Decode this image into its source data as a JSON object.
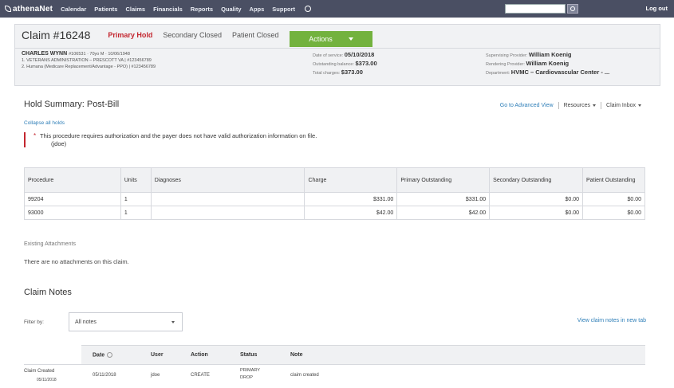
{
  "nav": {
    "logo": "athenaNet",
    "items": [
      "Calendar",
      "Patients",
      "Claims",
      "Financials",
      "Reports",
      "Quality",
      "Apps",
      "Support"
    ],
    "logout": "Log out"
  },
  "claim": {
    "title": "Claim #16248",
    "statuses": [
      "Primary Hold",
      "Secondary Closed",
      "Patient Closed"
    ],
    "actions_label": "Actions",
    "patient_name": "CHARLES WYNN",
    "patient_info": "#106531 · 70yo M · 10/06/1948",
    "insurance1": "1. VETERANS ADMINISTRATION – PRESCOTT VA | #123456789",
    "insurance2": "2. Humana (Medicare Replacement/Advantage - PPO) | #123456789",
    "date_of_service_label": "Date of service:",
    "date_of_service": "05/10/2018",
    "outstanding_label": "Outstanding balance:",
    "outstanding": "$373.00",
    "total_charges_label": "Total charges:",
    "total_charges": "$373.00",
    "supervising_label": "Supervising Provider:",
    "supervising": "William Koenig",
    "rendering_label": "Rendering Provider:",
    "rendering": "William Koenig",
    "department_label": "Department:",
    "department": "HVMC – Cardiovascular Center - ..."
  },
  "hold": {
    "title": "Hold Summary: Post-Bill",
    "advanced_view": "Go to Advanced View",
    "resources": "Resources",
    "claim_inbox": "Claim Inbox",
    "collapse": "Collapse all holds",
    "alert_text": "This procedure requires authorization and the payer does not have valid authorization information on file.",
    "alert_user": "(jdoe)"
  },
  "procedures": {
    "headers": [
      "Procedure",
      "Units",
      "Diagnoses",
      "Charge",
      "Primary Outstanding",
      "Secondary Outstanding",
      "Patient Outstanding"
    ],
    "rows": [
      [
        "99204",
        "1",
        "",
        "$331.00",
        "$331.00",
        "$0.00",
        "$0.00"
      ],
      [
        "93000",
        "1",
        "",
        "$42.00",
        "$42.00",
        "$0.00",
        "$0.00"
      ]
    ]
  },
  "attachments": {
    "title": "Existing Attachments",
    "text": "There are no attachments on this claim."
  },
  "notes": {
    "title": "Claim Notes",
    "filter_label": "Filter by:",
    "filter_value": "All notes",
    "view_new_tab": "View claim notes in new tab",
    "headers": [
      "Date",
      "User",
      "Action",
      "Status",
      "Note"
    ],
    "row": {
      "label": "Claim Created",
      "label_date": "05/11/2018",
      "date": "05/11/2018",
      "user": "jdoe",
      "action": "CREATE",
      "status_line1": "PRIMARY",
      "status_line2": "DROP",
      "note": "claim created"
    }
  }
}
